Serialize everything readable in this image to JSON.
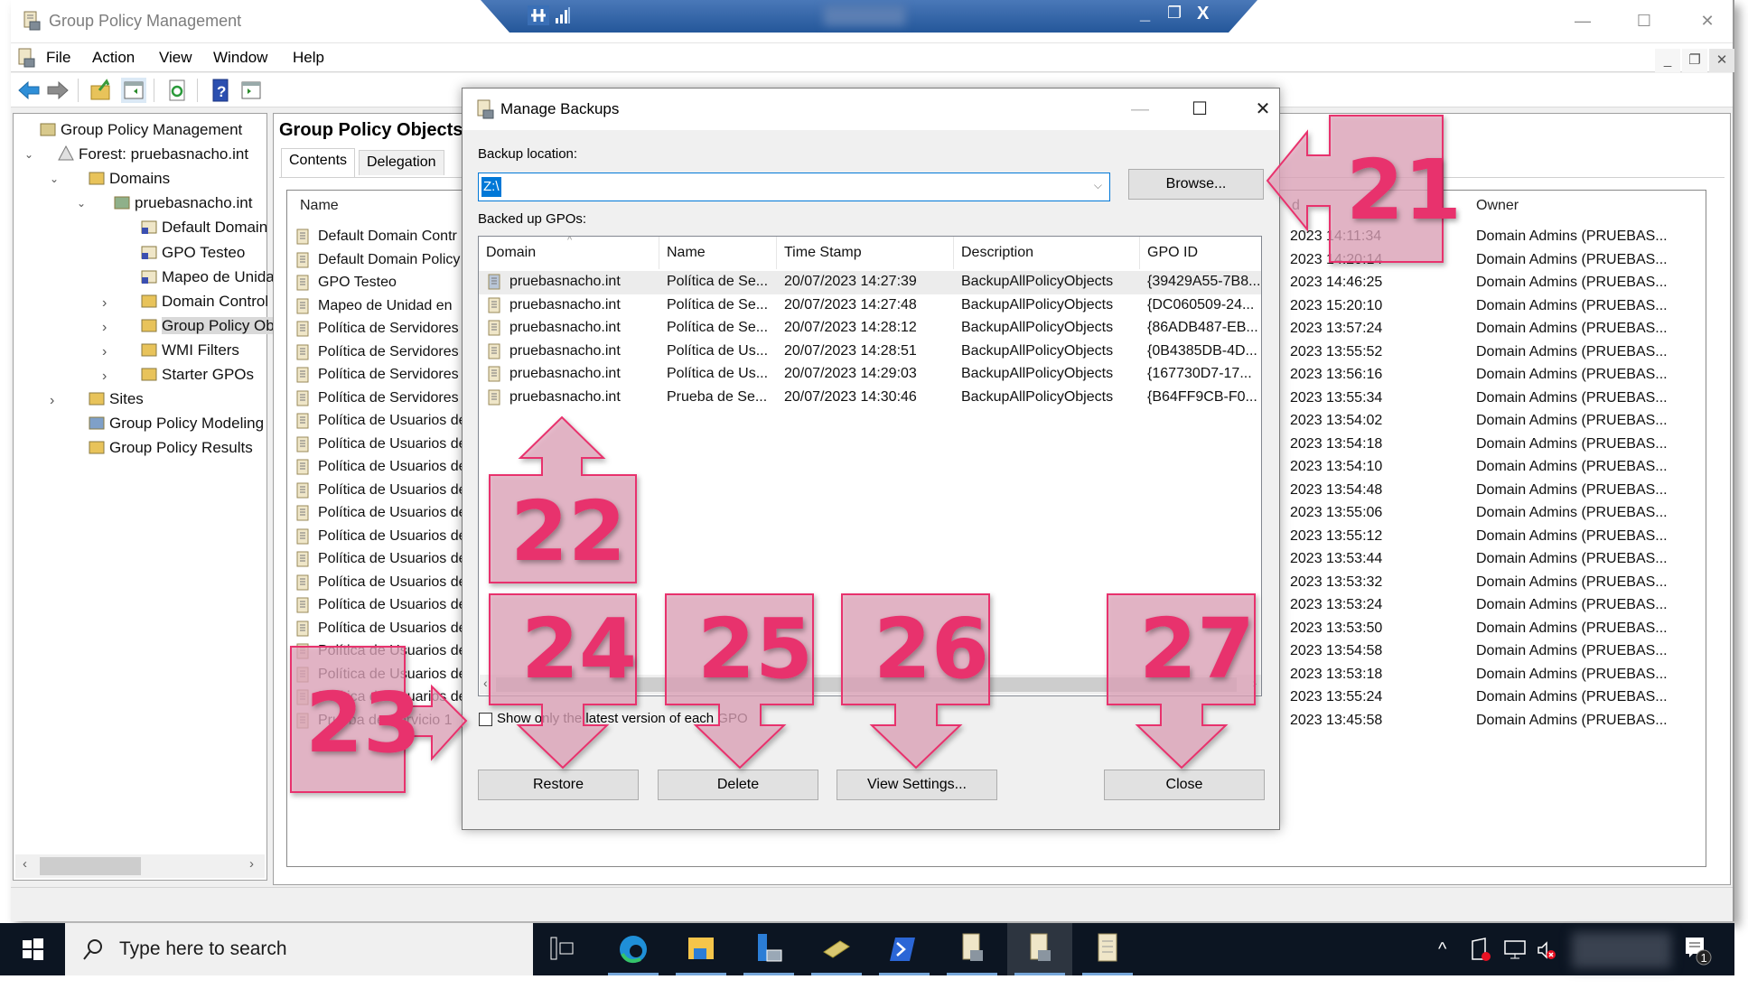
{
  "app": {
    "title": "Group Policy Management",
    "menu": [
      "File",
      "Action",
      "View",
      "Window",
      "Help"
    ],
    "window_controls": {
      "minimize": "—",
      "maximize": "☐",
      "close": "✕"
    },
    "mdi_controls": {
      "minimize": "_",
      "restore": "❐",
      "close": "✕"
    }
  },
  "remote_bar": {
    "pin_icon": "pin-icon",
    "signal_icon": "signal-icon",
    "minimize": "_",
    "restore": "❐",
    "close": "X"
  },
  "toolbar": {
    "buttons": [
      "back",
      "forward",
      "up-folder",
      "show-hide-console-tree",
      "refresh",
      "help",
      "show-hide-action-pane"
    ]
  },
  "tree": {
    "items": [
      {
        "label": "Group Policy Management",
        "icon": "gpm-icon",
        "level": 0
      },
      {
        "label": "Forest: pruebasnacho.int",
        "icon": "forest-icon",
        "level": 1,
        "expanded": true
      },
      {
        "label": "Domains",
        "icon": "domains-folder-icon",
        "level": 2,
        "expanded": true
      },
      {
        "label": "pruebasnacho.int",
        "icon": "domain-icon",
        "level": 3,
        "expanded": true
      },
      {
        "label": "Default Domain",
        "icon": "gpo-link-icon",
        "level": 4
      },
      {
        "label": "GPO Testeo",
        "icon": "gpo-link-icon",
        "level": 4
      },
      {
        "label": "Mapeo de Unidа",
        "icon": "gpo-link-icon",
        "level": 4
      },
      {
        "label": "Domain Control",
        "icon": "ou-icon",
        "level": 4,
        "expandable": true
      },
      {
        "label": "Group Policy Ob",
        "icon": "gpo-folder-icon",
        "level": 4,
        "expandable": true,
        "selected": true
      },
      {
        "label": "WMI Filters",
        "icon": "wmi-folder-icon",
        "level": 4,
        "expandable": true
      },
      {
        "label": "Starter GPOs",
        "icon": "starter-folder-icon",
        "level": 4,
        "expandable": true
      },
      {
        "label": "Sites",
        "icon": "sites-folder-icon",
        "level": 2,
        "expandable": true
      },
      {
        "label": "Group Policy Modeling",
        "icon": "modeling-icon",
        "level": 2
      },
      {
        "label": "Group Policy Results",
        "icon": "results-icon",
        "level": 2
      }
    ]
  },
  "right_pane": {
    "title": "Group Policy Objects",
    "tabs": [
      {
        "label": "Contents",
        "active": true
      },
      {
        "label": "Delegation",
        "active": false
      }
    ],
    "columns": {
      "name": "Name",
      "modified": "d",
      "owner": "Owner"
    },
    "rows": [
      {
        "name": "Default Domain Contr",
        "modified": "2023 14:11:34",
        "owner": "Domain Admins (PRUEBAS..."
      },
      {
        "name": "Default Domain Policy",
        "modified": "2023 14:20:14",
        "owner": "Domain Admins (PRUEBAS..."
      },
      {
        "name": "GPO Testeo",
        "modified": "2023 14:46:25",
        "owner": "Domain Admins (PRUEBAS..."
      },
      {
        "name": "Mapeo de Unidad en",
        "modified": "2023 15:20:10",
        "owner": "Domain Admins (PRUEBAS..."
      },
      {
        "name": "Política de Servidores",
        "modified": "2023 13:57:24",
        "owner": "Domain Admins (PRUEBAS..."
      },
      {
        "name": "Política de Servidores",
        "modified": "2023 13:55:52",
        "owner": "Domain Admins (PRUEBAS..."
      },
      {
        "name": "Política de Servidores",
        "modified": "2023 13:56:16",
        "owner": "Domain Admins (PRUEBAS..."
      },
      {
        "name": "Política de Servidores",
        "modified": "2023 13:55:34",
        "owner": "Domain Admins (PRUEBAS..."
      },
      {
        "name": "Política de Usuarios de",
        "modified": "2023 13:54:02",
        "owner": "Domain Admins (PRUEBAS..."
      },
      {
        "name": "Política de Usuarios de",
        "modified": "2023 13:54:18",
        "owner": "Domain Admins (PRUEBAS..."
      },
      {
        "name": "Política de Usuarios de",
        "modified": "2023 13:54:10",
        "owner": "Domain Admins (PRUEBAS..."
      },
      {
        "name": "Política de Usuarios de",
        "modified": "2023 13:54:48",
        "owner": "Domain Admins (PRUEBAS..."
      },
      {
        "name": "Política de Usuarios de",
        "modified": "2023 13:55:06",
        "owner": "Domain Admins (PRUEBAS..."
      },
      {
        "name": "Política de Usuarios de",
        "modified": "2023 13:55:12",
        "owner": "Domain Admins (PRUEBAS..."
      },
      {
        "name": "Política de Usuarios de",
        "modified": "2023 13:53:44",
        "owner": "Domain Admins (PRUEBAS..."
      },
      {
        "name": "Política de Usuarios de",
        "modified": "2023 13:53:32",
        "owner": "Domain Admins (PRUEBAS..."
      },
      {
        "name": "Política de Usuarios de",
        "modified": "2023 13:53:24",
        "owner": "Domain Admins (PRUEBAS..."
      },
      {
        "name": "Política de Usuarios de",
        "modified": "2023 13:53:50",
        "owner": "Domain Admins (PRUEBAS..."
      },
      {
        "name": "Política de Usuarios de",
        "modified": "2023 13:54:58",
        "owner": "Domain Admins (PRUEBAS..."
      },
      {
        "name": "Política de Usuarios de",
        "modified": "2023 13:53:18",
        "owner": "Domain Admins (PRUEBAS..."
      },
      {
        "name": "Política de Usuarios de",
        "modified": "2023 13:55:24",
        "owner": "Domain Admins (PRUEBAS..."
      },
      {
        "name": "Prueba de Servicio 1",
        "modified": "2023 13:45:58",
        "owner": "Domain Admins (PRUEBAS..."
      }
    ]
  },
  "dialog": {
    "title": "Manage Backups",
    "controls": {
      "minimize": "—",
      "maximize": "☐",
      "close": "✕"
    },
    "backup_location_label": "Backup location:",
    "backup_location_value": "Z:\\",
    "browse_label": "Browse...",
    "backed_up_label": "Backed up GPOs:",
    "columns": [
      "Domain",
      "Name",
      "Time Stamp",
      "Description",
      "GPO ID"
    ],
    "rows": [
      {
        "domain": "pruebasnacho.int",
        "name": "Política de Se...",
        "timestamp": "20/07/2023 14:27:39",
        "description": "BackupAllPolicyObjects",
        "gpo_id": "{39429A55-7B8..."
      },
      {
        "domain": "pruebasnacho.int",
        "name": "Política de Se...",
        "timestamp": "20/07/2023 14:27:48",
        "description": "BackupAllPolicyObjects",
        "gpo_id": "{DC060509-24..."
      },
      {
        "domain": "pruebasnacho.int",
        "name": "Política de Se...",
        "timestamp": "20/07/2023 14:28:12",
        "description": "BackupAllPolicyObjects",
        "gpo_id": "{86ADB487-EB..."
      },
      {
        "domain": "pruebasnacho.int",
        "name": "Política de Us...",
        "timestamp": "20/07/2023 14:28:51",
        "description": "BackupAllPolicyObjects",
        "gpo_id": "{0B4385DB-4D..."
      },
      {
        "domain": "pruebasnacho.int",
        "name": "Política de Us...",
        "timestamp": "20/07/2023 14:29:03",
        "description": "BackupAllPolicyObjects",
        "gpo_id": "{167730D7-17..."
      },
      {
        "domain": "pruebasnacho.int",
        "name": "Prueba de Se...",
        "timestamp": "20/07/2023 14:30:46",
        "description": "BackupAllPolicyObjects",
        "gpo_id": "{B64FF9CB-F0..."
      }
    ],
    "checkbox_label": "Show only the latest version of each GPO",
    "checkbox_checked": false,
    "buttons": {
      "restore": "Restore",
      "delete": "Delete",
      "view_settings": "View Settings...",
      "close": "Close"
    }
  },
  "annotations": {
    "color": "#e8336d",
    "fill": "#e2a6bc",
    "callouts": [
      "21",
      "22",
      "23",
      "24",
      "25",
      "26",
      "27"
    ]
  },
  "taskbar": {
    "search_placeholder": "Type here to search",
    "apps": [
      "task-view",
      "edge",
      "file-explorer",
      "server-manager",
      "tools",
      "powershell",
      "gpm",
      "gpm-active",
      "notepad-scroll"
    ],
    "notification_count": "1"
  }
}
